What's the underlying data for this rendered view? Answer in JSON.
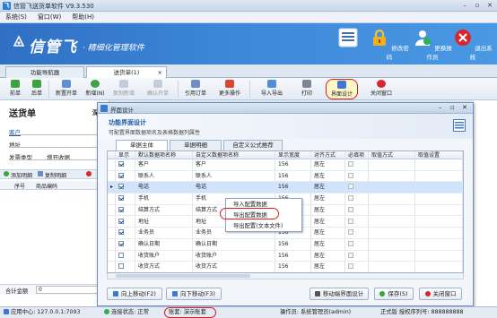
{
  "window": {
    "title": "信管飞送货单软件 V9.3.530",
    "logo": "飞"
  },
  "menu": [
    "系统(S)",
    "窗口(W)",
    "帮助(H)"
  ],
  "banner": {
    "brand": "信管飞",
    "tagline": "· 精细化管理软件",
    "buttons": [
      {
        "label": "",
        "icon": "window-layout-icon"
      },
      {
        "label": "修改密码",
        "icon": "lock-icon"
      },
      {
        "label": "更换操作员",
        "icon": "user-switch-icon"
      },
      {
        "label": "退出系统",
        "icon": "exit-icon"
      }
    ]
  },
  "tabs": [
    {
      "label": "功能导航器"
    },
    {
      "label": "送货单(1)",
      "close": "×"
    }
  ],
  "tab_close": "×",
  "toolbar": [
    {
      "label": "前单",
      "icon": "prev-arrow-icon",
      "disabled": false
    },
    {
      "label": "后单",
      "icon": "next-arrow-icon",
      "disabled": false
    },
    {
      "label": "新置开单",
      "icon": "new-doc-icon",
      "disabled": false
    },
    {
      "label": "新增(N)",
      "icon": "add-icon",
      "disabled": false
    },
    {
      "label": "复制新增",
      "icon": "copy-icon",
      "disabled": true
    },
    {
      "label": "确认开单",
      "icon": "confirm-icon",
      "disabled": true
    },
    {
      "label": "引用订单",
      "icon": "reference-order-icon",
      "disabled": false
    },
    {
      "label": "更多操作",
      "icon": "more-icon",
      "disabled": false
    },
    {
      "label": "导入导出",
      "icon": "import-export-icon",
      "disabled": false
    },
    {
      "label": "打印",
      "icon": "printer-icon",
      "disabled": false
    },
    {
      "label": "界面设计",
      "icon": "ui-design-icon",
      "disabled": false
    },
    {
      "label": "关闭窗口",
      "icon": "close-window-icon",
      "disabled": false
    }
  ],
  "doc": {
    "title": "送货单",
    "title_tail": "深",
    "customer_label": "客户",
    "address_label": "地址",
    "invoice_type_label": "发票类型",
    "invoice_type_value": "增开收据",
    "add_detail_label": "添加明细",
    "copy_detail_label": "复制明细",
    "col_seq": "序号",
    "col_name": "商品编码",
    "total_label": "合计金额",
    "total_value": "0"
  },
  "dialog": {
    "title": "界面设计",
    "header_title": "功能界面设计",
    "header_desc": "可配置界面数据项名及表格数据列属性",
    "tabs": [
      {
        "label": "单据主体",
        "active": true
      },
      {
        "label": "单据明细",
        "active": false
      },
      {
        "label": "自定义公式推荐",
        "active": false
      }
    ],
    "columns": [
      "显示",
      "默认数据项名称",
      "自定义数据项名称",
      "显示宽度",
      "对齐方式",
      "必填项",
      "取值方式",
      "取值设置"
    ],
    "rows": [
      {
        "show": true,
        "default": "客户",
        "custom": "客户",
        "width": "156",
        "align": "居左",
        "required": false,
        "selected": false
      },
      {
        "show": true,
        "default": "联系人",
        "custom": "联系人",
        "width": "156",
        "align": "居左",
        "required": false,
        "selected": false
      },
      {
        "show": true,
        "default": "电话",
        "custom": "电话",
        "width": "156",
        "align": "居左",
        "required": false,
        "selected": true
      },
      {
        "show": true,
        "default": "手机",
        "custom": "手机",
        "width": "156",
        "align": "居左",
        "required": false,
        "selected": false
      },
      {
        "show": true,
        "default": "结算方式",
        "custom": "结算方式",
        "width": "156",
        "align": "居左",
        "required": false,
        "selected": false
      },
      {
        "show": true,
        "default": "地址",
        "custom": "地址",
        "width": "156",
        "align": "居左",
        "required": false,
        "selected": false
      },
      {
        "show": true,
        "default": "业务员",
        "custom": "业务员",
        "width": "156",
        "align": "居左",
        "required": false,
        "selected": false
      },
      {
        "show": true,
        "default": "确认日期",
        "custom": "确认日期",
        "width": "156",
        "align": "居左",
        "required": false,
        "selected": false
      },
      {
        "show": false,
        "default": "收货账户",
        "custom": "收货账户",
        "width": "156",
        "align": "居左",
        "required": false,
        "selected": false
      },
      {
        "show": false,
        "default": "收货方式",
        "custom": "收货方式",
        "width": "156",
        "align": "居左",
        "required": false,
        "selected": false
      }
    ],
    "context_menu": [
      "导入配置数据",
      "导出配置数据",
      "导出配置(文本文件)"
    ],
    "buttons": {
      "move_up": "向上移动(F2)",
      "move_down": "向下移动(F3)",
      "sync": "移动端界面设计",
      "save": "保存(S)",
      "close": "关闭窗口"
    }
  },
  "status": {
    "app_center": "应用中心: 127.0.0.1:7093",
    "conn": "连接状态: 正常",
    "account": "账套: 演示账套",
    "operator": "操作员: 系统管理员(admin)",
    "license": "正式版 授权序列号: 888888888"
  },
  "colors": {
    "accent": "#2f6fc4",
    "highlight_ring": "#d81e1e",
    "selection": "#cfe3fb"
  }
}
